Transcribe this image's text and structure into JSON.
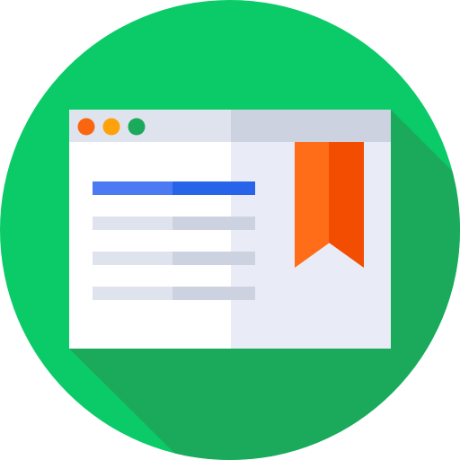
{
  "icon": {
    "kind": "browser-window-bookmark-icon",
    "colors": {
      "circle": "#0ACB67",
      "long_shadow": "#1BAA5C",
      "titlebar_left": "#DFE3EE",
      "titlebar_right": "#CDD2E1",
      "content_left": "#FFFFFF",
      "content_right": "#E9EBF6",
      "dot_close": "#FA6610",
      "dot_minimize": "#FFA10A",
      "dot_maximize": "#1BAA5C",
      "heading_bar_left": "#4C7AF2",
      "heading_bar_right": "#2864EA",
      "text_bar_left": "#DFE3EE",
      "text_bar_right": "#CDD2E1",
      "bookmark_left": "#FF6D18",
      "bookmark_right": "#F24D00"
    }
  }
}
